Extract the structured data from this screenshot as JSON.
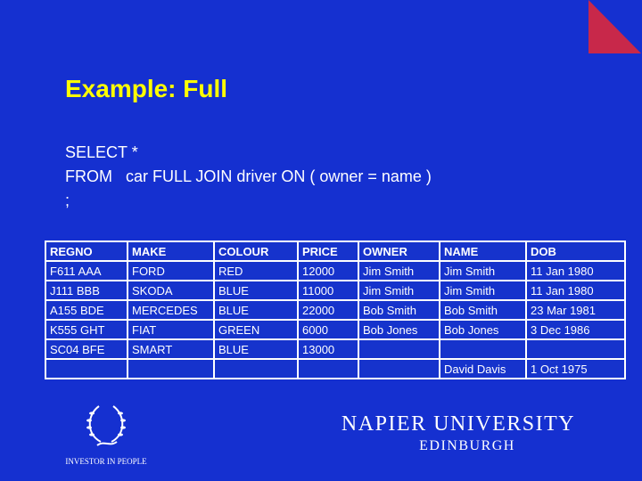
{
  "slide": {
    "title": "Example: Full",
    "sql_lines": [
      "SELECT *",
      "FROM   car FULL JOIN driver ON ( owner = name )",
      ";"
    ],
    "colors": {
      "background": "#1530d0",
      "title": "#ffff00",
      "corner": "#c8284a",
      "cell": "#1633cc"
    }
  },
  "table": {
    "headers": [
      "REGNO",
      "MAKE",
      "COLOUR",
      "PRICE",
      "OWNER",
      "NAME",
      "DOB"
    ],
    "rows": [
      [
        "F611 AAA",
        "FORD",
        "RED",
        "12000",
        "Jim Smith",
        "Jim Smith",
        "11 Jan 1980"
      ],
      [
        "J111 BBB",
        "SKODA",
        "BLUE",
        "11000",
        "Jim Smith",
        "Jim Smith",
        "11 Jan 1980"
      ],
      [
        "A155 BDE",
        "MERCEDES",
        "BLUE",
        "22000",
        "Bob Smith",
        "Bob Smith",
        "23 Mar 1981"
      ],
      [
        "K555 GHT",
        "FIAT",
        "GREEN",
        "6000",
        "Bob Jones",
        "Bob Jones",
        "3 Dec 1986"
      ],
      [
        "SC04 BFE",
        "SMART",
        "BLUE",
        "13000",
        "",
        "",
        ""
      ],
      [
        "",
        "",
        "",
        "",
        "",
        "David Davis",
        "1 Oct 1975"
      ]
    ]
  },
  "footer": {
    "iip_label": "INVESTOR IN PEOPLE",
    "university": "NAPIER UNIVERSITY",
    "city": "EDINBURGH"
  }
}
